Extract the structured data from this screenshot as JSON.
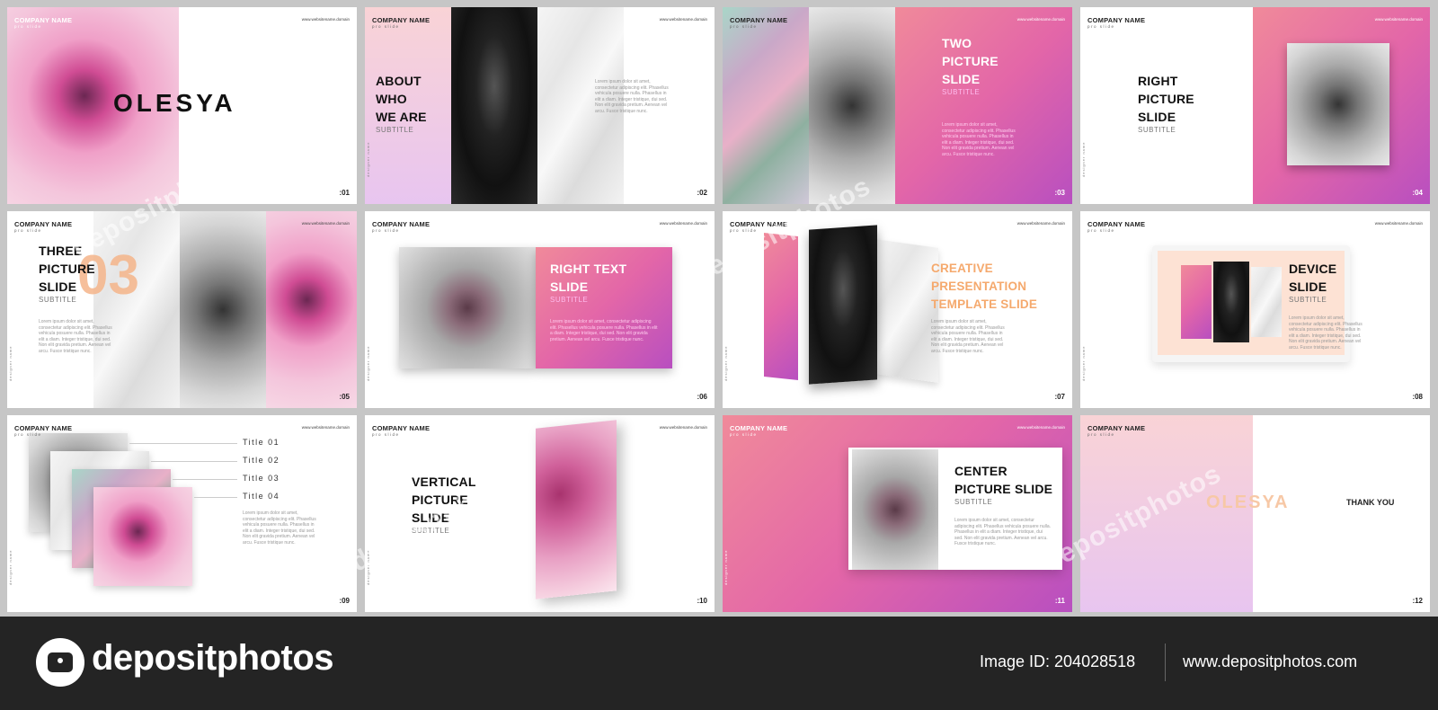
{
  "common": {
    "company": "COMPANY NAME",
    "tag": "pro slide",
    "domain": "www.websitename.domain",
    "designer": "designer name",
    "body_text": "Lorem ipsum dolor sit amet, consectetur adipiscing elit. Phasellus vehicula posuere nulla. Phasellus in elit a diam. Integer tristique, dui sed. Non elit gravida pretium. Aenean vel arcu. Fusce tristique nunc."
  },
  "slides": {
    "s01": {
      "title": "OLESYA",
      "number": ":01"
    },
    "s02": {
      "title_lines": [
        "ABOUT",
        "WHO",
        "WE ARE"
      ],
      "subtitle": "SUBTITLE",
      "number": ":02"
    },
    "s03": {
      "title_lines": [
        "TWO",
        "PICTURE",
        "SLIDE"
      ],
      "subtitle": "SUBTITLE",
      "number": ":03"
    },
    "s04": {
      "title_lines": [
        "RIGHT",
        "PICTURE",
        "SLIDE"
      ],
      "subtitle": "SUBTITLE",
      "number": ":04"
    },
    "s05": {
      "title_lines": [
        "THREE",
        "PICTURE",
        "SLIDE"
      ],
      "big_number": "03",
      "subtitle": "SUBTITLE",
      "number": ":05"
    },
    "s06": {
      "title_lines": [
        "RIGHT TEXT",
        "SLIDE"
      ],
      "subtitle": "SUBTITLE",
      "number": ":06"
    },
    "s07": {
      "title_lines": [
        "CREATIVE",
        "PRESENTATION",
        "TEMPLATE SLIDE"
      ],
      "number": ":07"
    },
    "s08": {
      "title_lines": [
        "DEVICE",
        "SLIDE"
      ],
      "subtitle": "SUBTITLE",
      "number": ":08"
    },
    "s09": {
      "titles": [
        "Title 01",
        "Title 02",
        "Title 03",
        "Title 04"
      ],
      "number": ":09"
    },
    "s10": {
      "title_lines": [
        "VERTICAL",
        "PICTURE",
        "SLIDE"
      ],
      "subtitle": "SUBTITLE",
      "number": ":10"
    },
    "s11": {
      "title_lines": [
        "CENTER",
        "PICTURE SLIDE"
      ],
      "subtitle": "SUBTITLE",
      "number": ":11"
    },
    "s12": {
      "title": "OLESYA",
      "thanks": "THANK YOU",
      "number": ":12"
    }
  },
  "watermark": "depositphotos",
  "footer": {
    "logo_text": "depositphotos",
    "image_id": "Image ID: 204028518",
    "site": "www.depositphotos.com"
  },
  "colors": {
    "accent_peach": "#f5b58a",
    "footer_bg": "#242424"
  }
}
